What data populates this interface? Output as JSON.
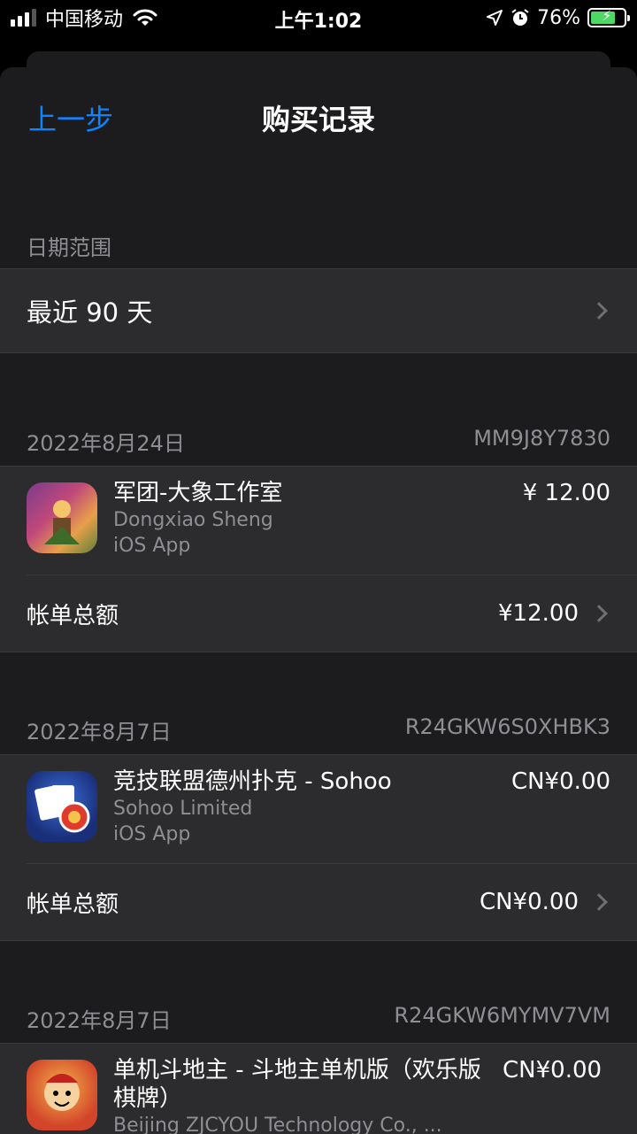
{
  "status": {
    "carrier": "中国移动",
    "time": "上午1:02",
    "battery_percent": "76%",
    "battery_level": 0.76
  },
  "nav": {
    "back_label": "上一步",
    "title": "购买记录"
  },
  "date_range": {
    "header": "日期范围",
    "value": "最近 90 天"
  },
  "purchases": [
    {
      "date": "2022年8月24日",
      "order_id": "MM9J8Y7830",
      "item_title": "军团-大象工作室",
      "developer": "Dongxiao Sheng",
      "type": "iOS App",
      "price": "¥ 12.00",
      "total_label": "帐单总额",
      "total": "¥12.00",
      "icon": "legion-app-icon"
    },
    {
      "date": "2022年8月7日",
      "order_id": "R24GKW6S0XHBK3",
      "item_title": "竞技联盟德州扑克 - Sohoo",
      "developer": "Sohoo Limited",
      "type": "iOS App",
      "price": "CN¥0.00",
      "total_label": "帐单总额",
      "total": "CN¥0.00",
      "icon": "poker-app-icon"
    },
    {
      "date": "2022年8月7日",
      "order_id": "R24GKW6MYMV7VM",
      "item_title": "单机斗地主 - 斗地主单机版（欢乐版棋牌）",
      "developer": "Beijing ZJCYOU Technology Co., ...",
      "price": "CN¥0.00",
      "icon": "doudizhu-app-icon"
    }
  ]
}
